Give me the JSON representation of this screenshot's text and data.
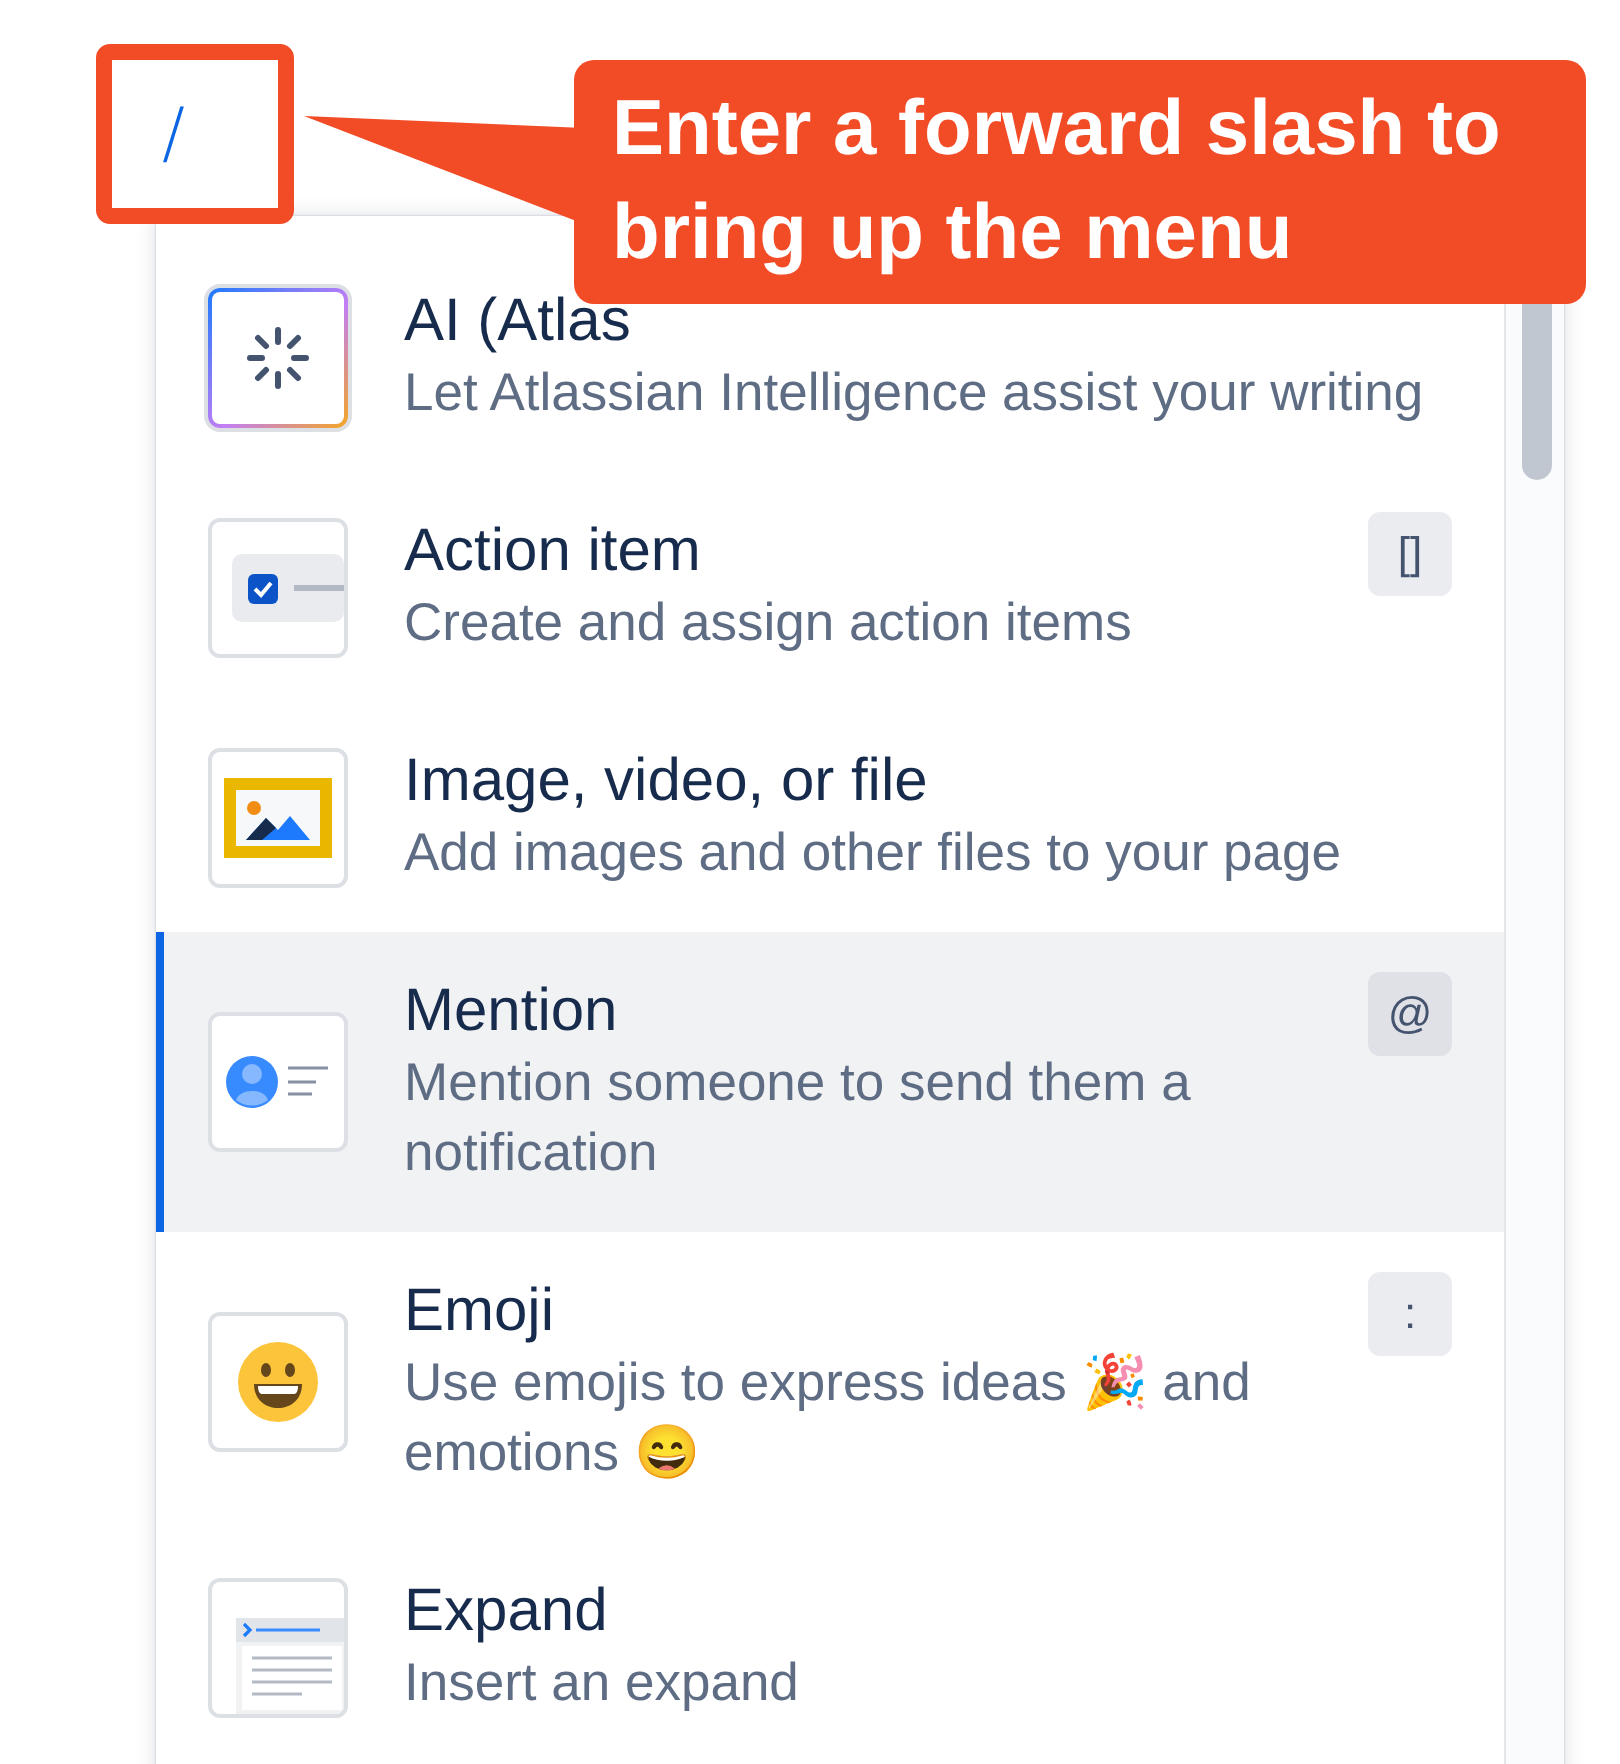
{
  "input": {
    "value": "/"
  },
  "callout": {
    "text": "Enter a forward slash to bring up the menu"
  },
  "menu": {
    "items": [
      {
        "kind": "ai",
        "title": "AI (Atlas",
        "description": "Let Atlassian Intelligence assist your writing",
        "selected": false
      },
      {
        "kind": "action",
        "title": "Action item",
        "description": "Create and assign action items",
        "shortcut": "[]",
        "selected": false
      },
      {
        "kind": "media",
        "title": "Image, video, or file",
        "description": "Add images and other files to your page",
        "selected": false
      },
      {
        "kind": "mention",
        "title": "Mention",
        "description": "Mention someone to send them a notification",
        "shortcut": "@",
        "selected": true
      },
      {
        "kind": "emoji",
        "title": "Emoji",
        "description": "Use emojis to express ideas 🎉 and emotions 😄",
        "shortcut": ":",
        "selected": false
      },
      {
        "kind": "expand",
        "title": "Expand",
        "description": "Insert an expand",
        "selected": false
      }
    ]
  }
}
